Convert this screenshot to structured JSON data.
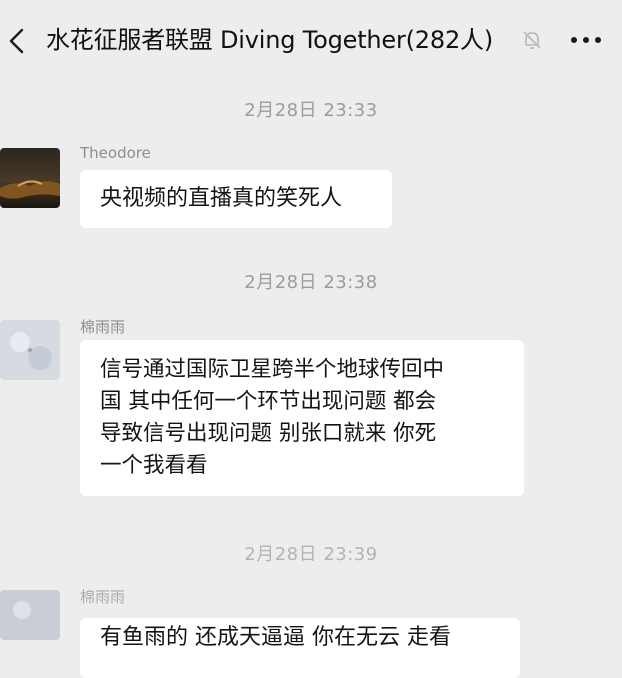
{
  "header": {
    "title": "水花征服者联盟 Diving Together(282人)",
    "back_icon": "chevron-left-icon",
    "mute_icon": "bell-off-icon",
    "more_icon": "more-horizontal-icon"
  },
  "messages": [
    {
      "time": "2月28日 23:33",
      "sender": "Theodore",
      "lines": [
        "央视频的直播真的笑死人"
      ]
    },
    {
      "time": "2月28日 23:38",
      "sender": "棉雨雨",
      "lines": [
        "信号通过国际卫星跨半个地球传回中",
        "国 其中任何一个环节出现问题 都会",
        "导致信号出现问题 别张口就来 你死",
        "一个我看看"
      ]
    },
    {
      "time": "2月28日 23:39",
      "sender": "棉雨雨",
      "lines": [
        "有鱼雨的 还成天逼逼 你在无云 走看"
      ]
    }
  ]
}
